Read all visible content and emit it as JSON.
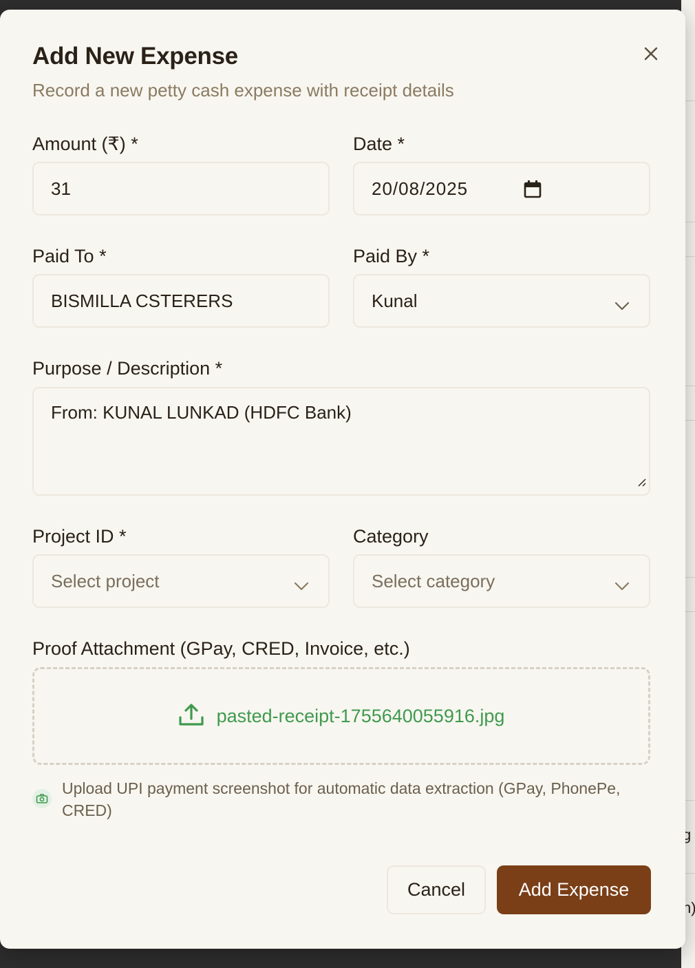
{
  "background": {
    "fragments": [
      "g",
      "n)"
    ]
  },
  "dialog": {
    "title": "Add New Expense",
    "subtitle": "Record a new petty cash expense with receipt details",
    "close_icon": "close-icon"
  },
  "form": {
    "amount": {
      "label": "Amount (₹) *",
      "value": "31"
    },
    "date": {
      "label": "Date *",
      "value": "20/08/2025",
      "icon": "calendar-icon"
    },
    "paid_to": {
      "label": "Paid To *",
      "value": "BISMILLA CSTERERS"
    },
    "paid_by": {
      "label": "Paid By *",
      "value": "Kunal",
      "icon": "chevron-down-icon"
    },
    "purpose": {
      "label": "Purpose / Description *",
      "value": "From: KUNAL LUNKAD (HDFC Bank)"
    },
    "project": {
      "label": "Project ID *",
      "placeholder": "Select project",
      "icon": "chevron-down-icon"
    },
    "category": {
      "label": "Category",
      "placeholder": "Select category",
      "icon": "chevron-down-icon"
    },
    "attachment": {
      "label": "Proof Attachment (GPay, CRED, Invoice, etc.)",
      "file_name": "pasted-receipt-1755640055916.jpg",
      "icon": "upload-icon"
    },
    "hint": {
      "icon": "camera-icon",
      "text": "Upload UPI payment screenshot for automatic data extraction (GPay, PhonePe, CRED)"
    }
  },
  "actions": {
    "cancel_label": "Cancel",
    "submit_label": "Add Expense"
  },
  "colors": {
    "accent": "#7a3f17",
    "success": "#3f9a4f",
    "muted": "#8a7b62"
  }
}
